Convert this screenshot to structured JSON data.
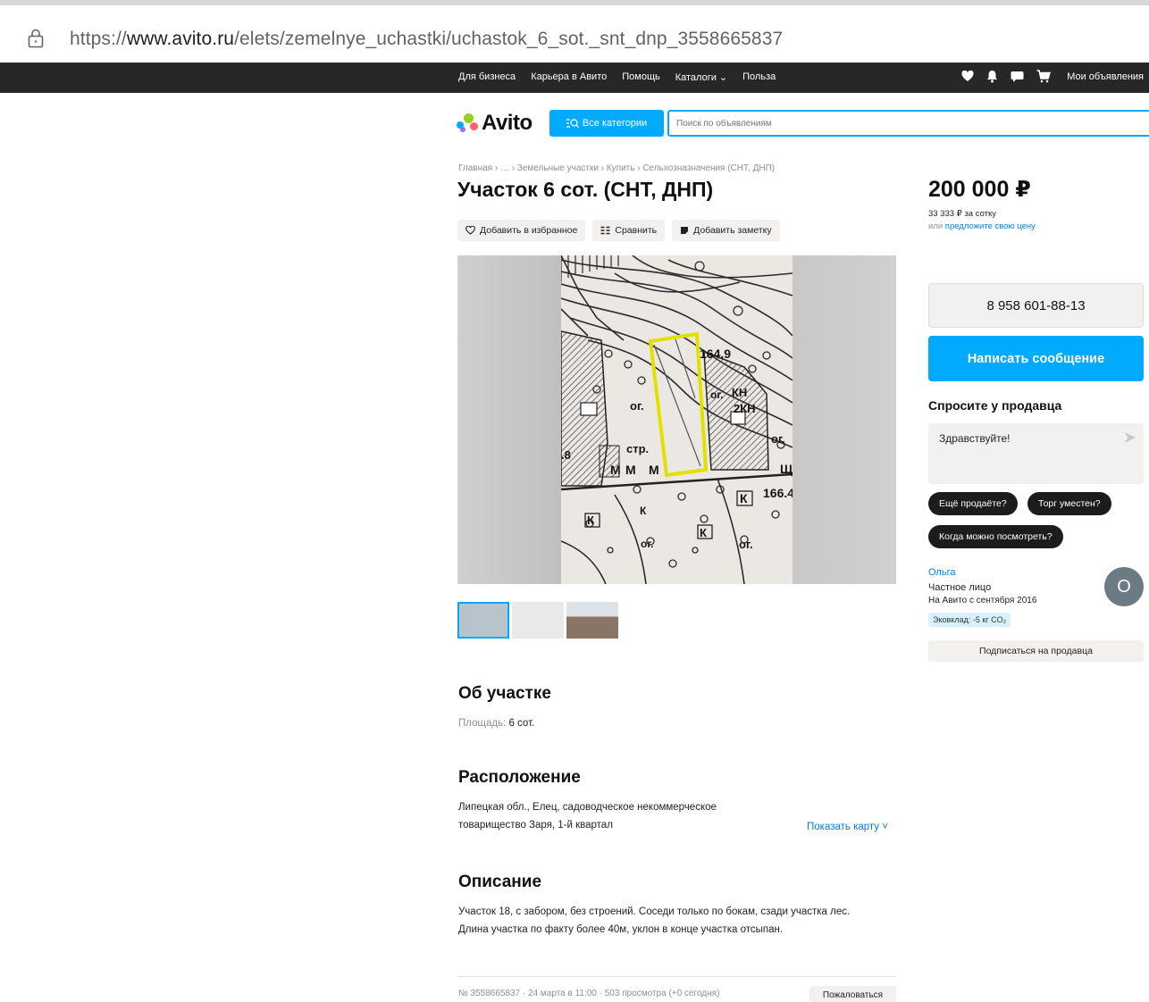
{
  "browser": {
    "url_scheme": "https://",
    "url_host": "www.avito.ru",
    "url_path": "/elets/zemelnye_uchastki/uchastok_6_sot._snt_dnp_3558665837"
  },
  "topbar": {
    "nav": [
      "Для бизнеса",
      "Карьера в Авито",
      "Помощь",
      "Каталоги ⌄",
      "Польза"
    ],
    "my_ads": "Мои объявления"
  },
  "header": {
    "logo": "Avito",
    "categories_button": "Все категории",
    "search_placeholder": "Поиск по объявлениям"
  },
  "breadcrumb": "Главная › … › Земельные участки › Купить › Сельхозназначения (СНТ, ДНП)",
  "title": "Участок 6 сот. (СНТ, ДНП)",
  "actions": {
    "favorite": "Добавить в избранное",
    "compare": "Сравнить",
    "note": "Добавить заметку"
  },
  "about": {
    "heading": "Об участке",
    "area_label": "Площадь: ",
    "area_value": "6 сот."
  },
  "location": {
    "heading": "Расположение",
    "line1": "Липецкая обл., Елец, садоводческое некоммерческое",
    "line2": "товарищество Заря, 1-й квартал",
    "show_map": "Показать карту ˅"
  },
  "description": {
    "heading": "Описание",
    "line1": "Участок 18, с забором, без строений. Соседи только по бокам, сзади участка лес.",
    "line2": "Длина участка по факту более 40м, уклон в конце участка отсыпан."
  },
  "footer": {
    "meta": "№ 3558665837 · 24 марта в 11:00 · 503 просмотра (+0 сегодня)",
    "report": "Пожаловаться"
  },
  "sidebar": {
    "price": "200 000 ₽",
    "per_sotka": "33 333 ₽ за сотку",
    "offer_prefix": "или ",
    "offer_link": "предложите свою цену",
    "phone": "8 958 601-88-13",
    "write_button": "Написать сообщение",
    "ask_heading": "Спросите у продавца",
    "message_value": "Здравствуйте!",
    "chips": [
      "Ещё продаёте?",
      "Торг уместен?",
      "Когда можно посмотреть?"
    ],
    "seller_name": "Ольга",
    "seller_type": "Частное лицо",
    "seller_since": "На Авито с сентября 2016",
    "eco": "Эковклад: -5 кг CO₂",
    "avatar_letter": "О",
    "subscribe": "Подписаться на продавца"
  },
  "map_labels": [
    "164.9",
    "КН",
    "2КН",
    "ог.",
    "стр.",
    "ог.",
    "М",
    "М",
    "М",
    "166.4",
    "К",
    "К",
    "К",
    "ог.",
    "ог.",
    "Щ",
    ".8"
  ],
  "colors": {
    "accent": "#00aaff",
    "topbar": "#272727",
    "link": "#0a7ad8",
    "plot_outline": "#e3e000"
  }
}
